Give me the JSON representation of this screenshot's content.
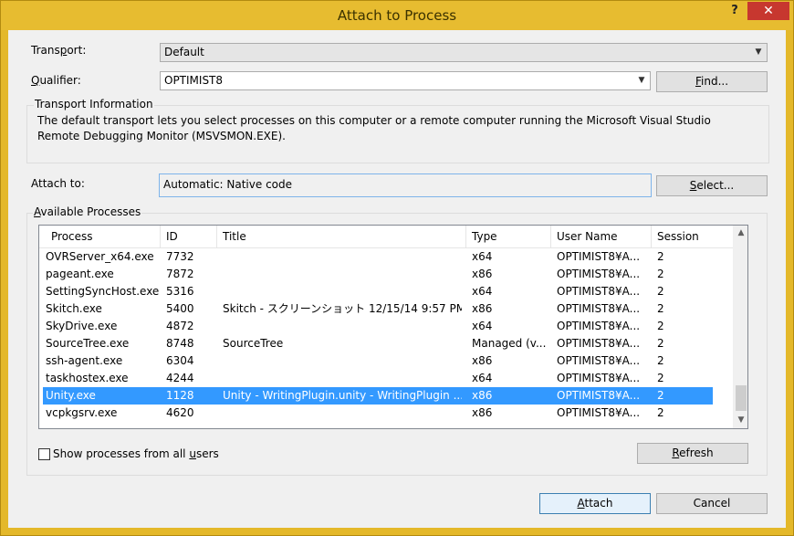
{
  "window": {
    "title": "Attach to Process",
    "help_glyph": "?",
    "close_glyph": "✕"
  },
  "transport": {
    "label_pre": "Trans",
    "label_u": "p",
    "label_post": "ort:",
    "value": "Default"
  },
  "qualifier": {
    "label_u": "Q",
    "label_post": "ualifier:",
    "value": "OPTIMIST8"
  },
  "find_button": {
    "label_u": "F",
    "label_post": "ind..."
  },
  "transport_info": {
    "heading": "Transport Information",
    "text": "The default transport lets you select processes on this computer or a remote computer running the Microsoft Visual Studio Remote Debugging Monitor (MSVSMON.EXE)."
  },
  "attach_to": {
    "label": "Attach to:",
    "value": "Automatic: Native code"
  },
  "select_button": {
    "label_u": "S",
    "label_post": "elect..."
  },
  "available": {
    "label_u": "A",
    "label_post": "vailable Processes"
  },
  "columns": [
    "Process",
    "ID",
    "Title",
    "Type",
    "User Name",
    "Session"
  ],
  "processes": [
    {
      "process": "OVRServer_x64.exe",
      "id": "7732",
      "title": "",
      "type": "x64",
      "user": "OPTIMIST8¥A...",
      "session": "2"
    },
    {
      "process": "pageant.exe",
      "id": "7872",
      "title": "",
      "type": "x86",
      "user": "OPTIMIST8¥A...",
      "session": "2"
    },
    {
      "process": "SettingSyncHost.exe",
      "id": "5316",
      "title": "",
      "type": "x64",
      "user": "OPTIMIST8¥A...",
      "session": "2"
    },
    {
      "process": "Skitch.exe",
      "id": "5400",
      "title": "Skitch - スクリーンショット 12/15/14 9:57 PM",
      "type": "x86",
      "user": "OPTIMIST8¥A...",
      "session": "2"
    },
    {
      "process": "SkyDrive.exe",
      "id": "4872",
      "title": "",
      "type": "x64",
      "user": "OPTIMIST8¥A...",
      "session": "2"
    },
    {
      "process": "SourceTree.exe",
      "id": "8748",
      "title": "SourceTree",
      "type": "Managed (v...",
      "user": "OPTIMIST8¥A...",
      "session": "2"
    },
    {
      "process": "ssh-agent.exe",
      "id": "6304",
      "title": "",
      "type": "x86",
      "user": "OPTIMIST8¥A...",
      "session": "2"
    },
    {
      "process": "taskhostex.exe",
      "id": "4244",
      "title": "",
      "type": "x64",
      "user": "OPTIMIST8¥A...",
      "session": "2"
    },
    {
      "process": "Unity.exe",
      "id": "1128",
      "title": "Unity - WritingPlugin.unity - WritingPlugin ...",
      "type": "x86",
      "user": "OPTIMIST8¥A...",
      "session": "2"
    },
    {
      "process": "vcpkgsrv.exe",
      "id": "4620",
      "title": "",
      "type": "x86",
      "user": "OPTIMIST8¥A...",
      "session": "2"
    }
  ],
  "selected_process": "Unity.exe",
  "show_all": {
    "label_pre": "Show processes from all ",
    "label_u": "u",
    "label_post": "sers",
    "checked": false
  },
  "refresh_button": {
    "label_u": "R",
    "label_post": "efresh"
  },
  "attach_button": {
    "label_u": "A",
    "label_post": "ttach"
  },
  "cancel_button": {
    "label": "Cancel"
  },
  "colors": {
    "titlebar": "#e7bc30",
    "close": "#c7372f",
    "selection": "#3399ff",
    "dialog_bg": "#f0f0f0"
  }
}
